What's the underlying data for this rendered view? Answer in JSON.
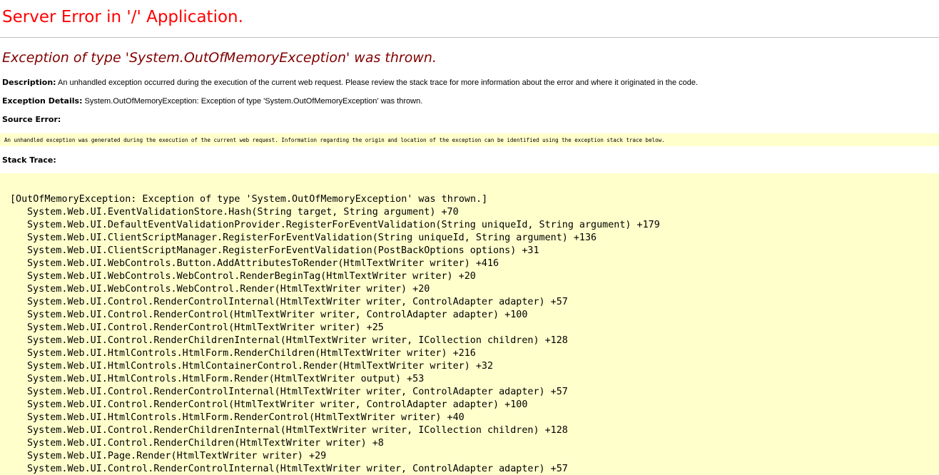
{
  "page": {
    "title": "Server Error in '/' Application.",
    "exception_heading": "Exception of type 'System.OutOfMemoryException' was thrown."
  },
  "description": {
    "label": "Description:",
    "text": "An unhandled exception occurred during the execution of the current web request. Please review the stack trace for more information about the error and where it originated in the code."
  },
  "exception_details": {
    "label": "Exception Details:",
    "text": "System.OutOfMemoryException: Exception of type 'System.OutOfMemoryException' was thrown."
  },
  "source_error": {
    "label": "Source Error:",
    "text": "An unhandled exception was generated during the execution of the current web request. Information regarding the origin and location of the exception can be identified using the exception stack trace below."
  },
  "stack_trace": {
    "label": "Stack Trace:",
    "header": "[OutOfMemoryException: Exception of type 'System.OutOfMemoryException' was thrown.]",
    "frames": [
      "System.Web.UI.EventValidationStore.Hash(String target, String argument) +70",
      "System.Web.UI.DefaultEventValidationProvider.RegisterForEventValidation(String uniqueId, String argument) +179",
      "System.Web.UI.ClientScriptManager.RegisterForEventValidation(String uniqueId, String argument) +136",
      "System.Web.UI.ClientScriptManager.RegisterForEventValidation(PostBackOptions options) +31",
      "System.Web.UI.WebControls.Button.AddAttributesToRender(HtmlTextWriter writer) +416",
      "System.Web.UI.WebControls.WebControl.RenderBeginTag(HtmlTextWriter writer) +20",
      "System.Web.UI.WebControls.WebControl.Render(HtmlTextWriter writer) +20",
      "System.Web.UI.Control.RenderControlInternal(HtmlTextWriter writer, ControlAdapter adapter) +57",
      "System.Web.UI.Control.RenderControl(HtmlTextWriter writer, ControlAdapter adapter) +100",
      "System.Web.UI.Control.RenderControl(HtmlTextWriter writer) +25",
      "System.Web.UI.Control.RenderChildrenInternal(HtmlTextWriter writer, ICollection children) +128",
      "System.Web.UI.HtmlControls.HtmlForm.RenderChildren(HtmlTextWriter writer) +216",
      "System.Web.UI.HtmlControls.HtmlContainerControl.Render(HtmlTextWriter writer) +32",
      "System.Web.UI.HtmlControls.HtmlForm.Render(HtmlTextWriter output) +53",
      "System.Web.UI.Control.RenderControlInternal(HtmlTextWriter writer, ControlAdapter adapter) +57",
      "System.Web.UI.Control.RenderControl(HtmlTextWriter writer, ControlAdapter adapter) +100",
      "System.Web.UI.HtmlControls.HtmlForm.RenderControl(HtmlTextWriter writer) +40",
      "System.Web.UI.Control.RenderChildrenInternal(HtmlTextWriter writer, ICollection children) +128",
      "System.Web.UI.Control.RenderChildren(HtmlTextWriter writer) +8",
      "System.Web.UI.Page.Render(HtmlTextWriter writer) +29",
      "System.Web.UI.Control.RenderControlInternal(HtmlTextWriter writer, ControlAdapter adapter) +57"
    ]
  },
  "colors": {
    "title": "#ff0000",
    "exception_heading": "#800000",
    "code_background": "#ffffcc",
    "rule": "#c0c0c0"
  }
}
